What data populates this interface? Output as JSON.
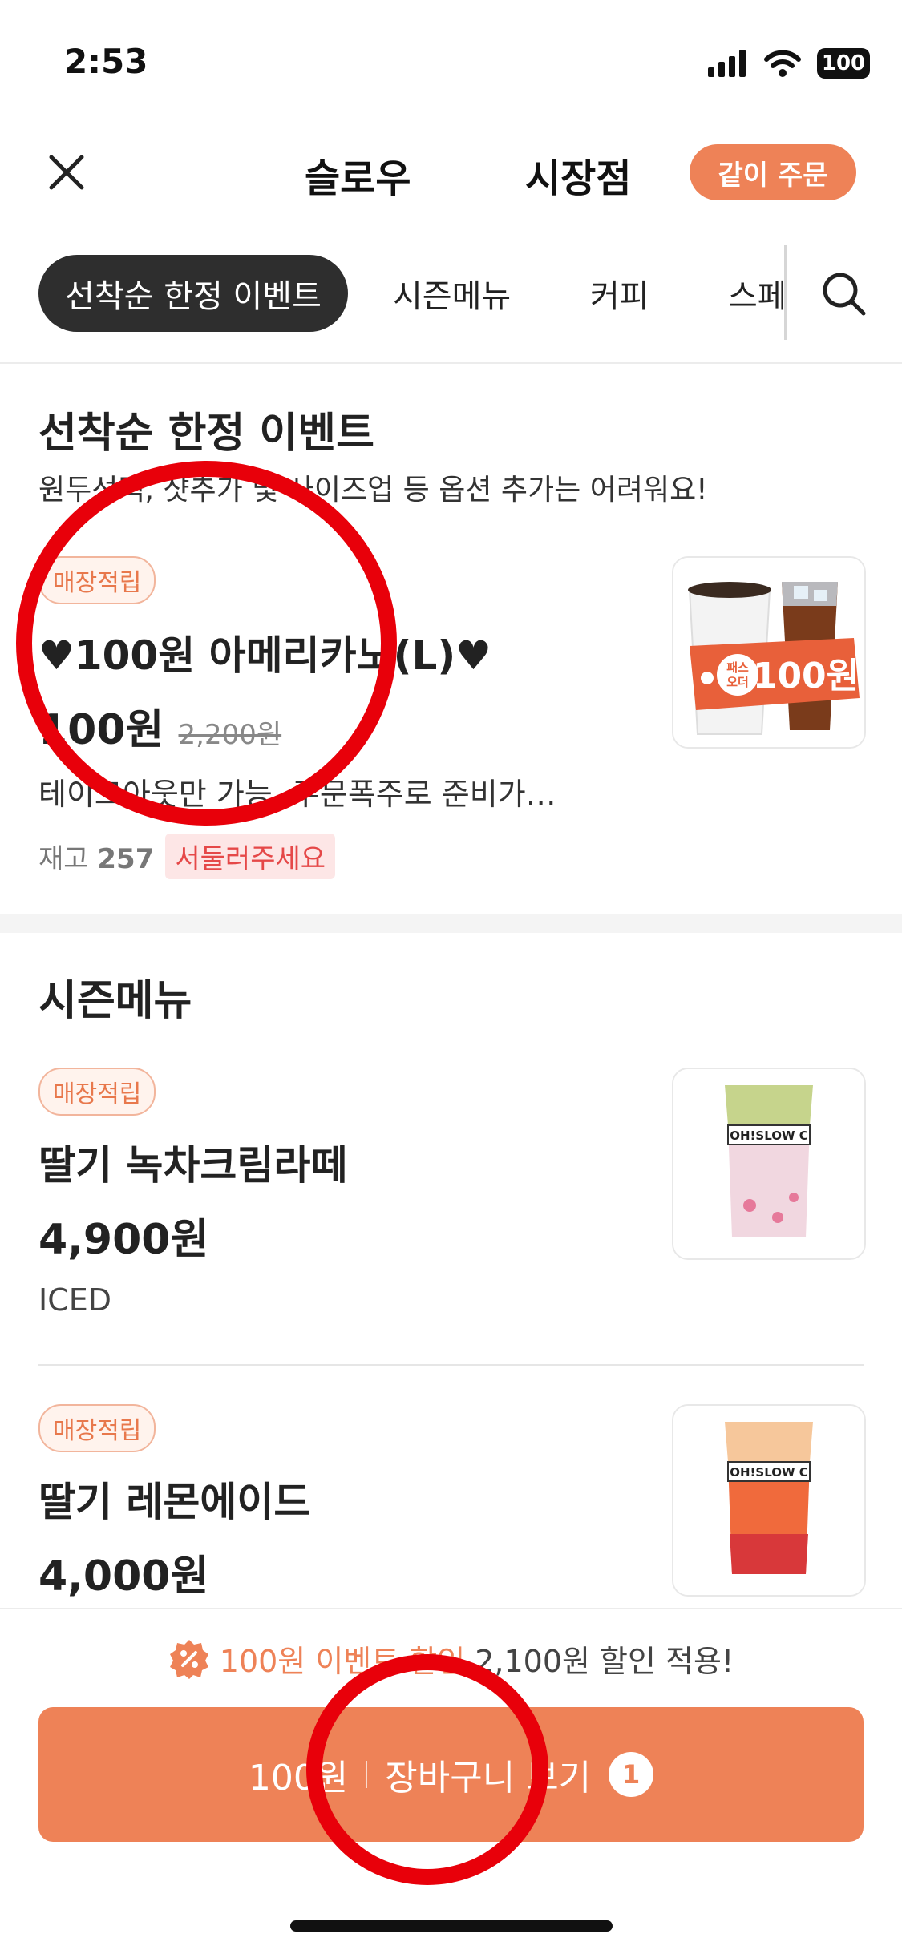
{
  "status": {
    "time": "2:53",
    "battery": "100"
  },
  "header": {
    "store_part1": "슬로우",
    "store_part2": "시장점",
    "together_button": "같이 주문"
  },
  "tabs": [
    {
      "label": "선착순 한정 이벤트",
      "active": true
    },
    {
      "label": "시즌메뉴"
    },
    {
      "label": "커피"
    },
    {
      "label": "스페"
    }
  ],
  "event_section": {
    "title": "선착순 한정 이벤트",
    "note": "원두선택, 샷추가 및 사이즈업 등 옵션 추가는 어려워요!",
    "item": {
      "badge": "매장적립",
      "name": "♥100원 아메리카노(L)♥",
      "price": "100원",
      "original_price": "2,200원",
      "description": "테이크아웃만 가능, 주문폭주로 준비가…",
      "stock_label": "재고",
      "stock_count": "257",
      "hurry": "서둘러주세요",
      "image_tag": "100원",
      "image_tag_small": "패스 오더"
    }
  },
  "season_section": {
    "title": "시즌메뉴",
    "items": [
      {
        "badge": "매장적립",
        "name": "딸기 녹차크림라떼",
        "price": "4,900원",
        "option": "ICED",
        "cup_text": "OH!SLOW C"
      },
      {
        "badge": "매장적립",
        "name": "딸기 레몬에이드",
        "price": "4,000원",
        "cup_text": "OH!SLOW C"
      }
    ]
  },
  "bottom": {
    "discount_event": "100원 이벤트 할인",
    "discount_text": "2,100원 할인 적용!",
    "cart_price": "100원",
    "cart_label": "장바구니 보기",
    "cart_count": "1"
  },
  "colors": {
    "accent": "#ee8257",
    "annotation": "#e8000a",
    "dark_tab": "#2e2e2e"
  }
}
